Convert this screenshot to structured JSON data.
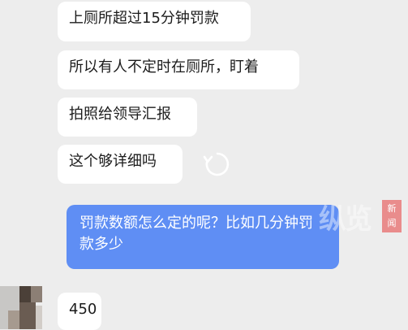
{
  "messages": {
    "m1": "上厕所超过15分钟罚款",
    "m2": "所以有人不定时在厕所，盯着",
    "m3": "拍照给领导汇报",
    "m4": "这个够详细吗",
    "m5": "罚款数额怎么定的呢？比如几分钟罚款多少",
    "m6": "450"
  },
  "watermark": {
    "main": "纵览",
    "badge_top": "新",
    "badge_bottom": "闻"
  },
  "icons": {
    "reload": "refresh-icon",
    "avatar": "avatar-pixelated"
  },
  "colors": {
    "background": "#ededed",
    "incoming_bubble": "#ffffff",
    "outgoing_bubble": "#5f8ef4"
  }
}
